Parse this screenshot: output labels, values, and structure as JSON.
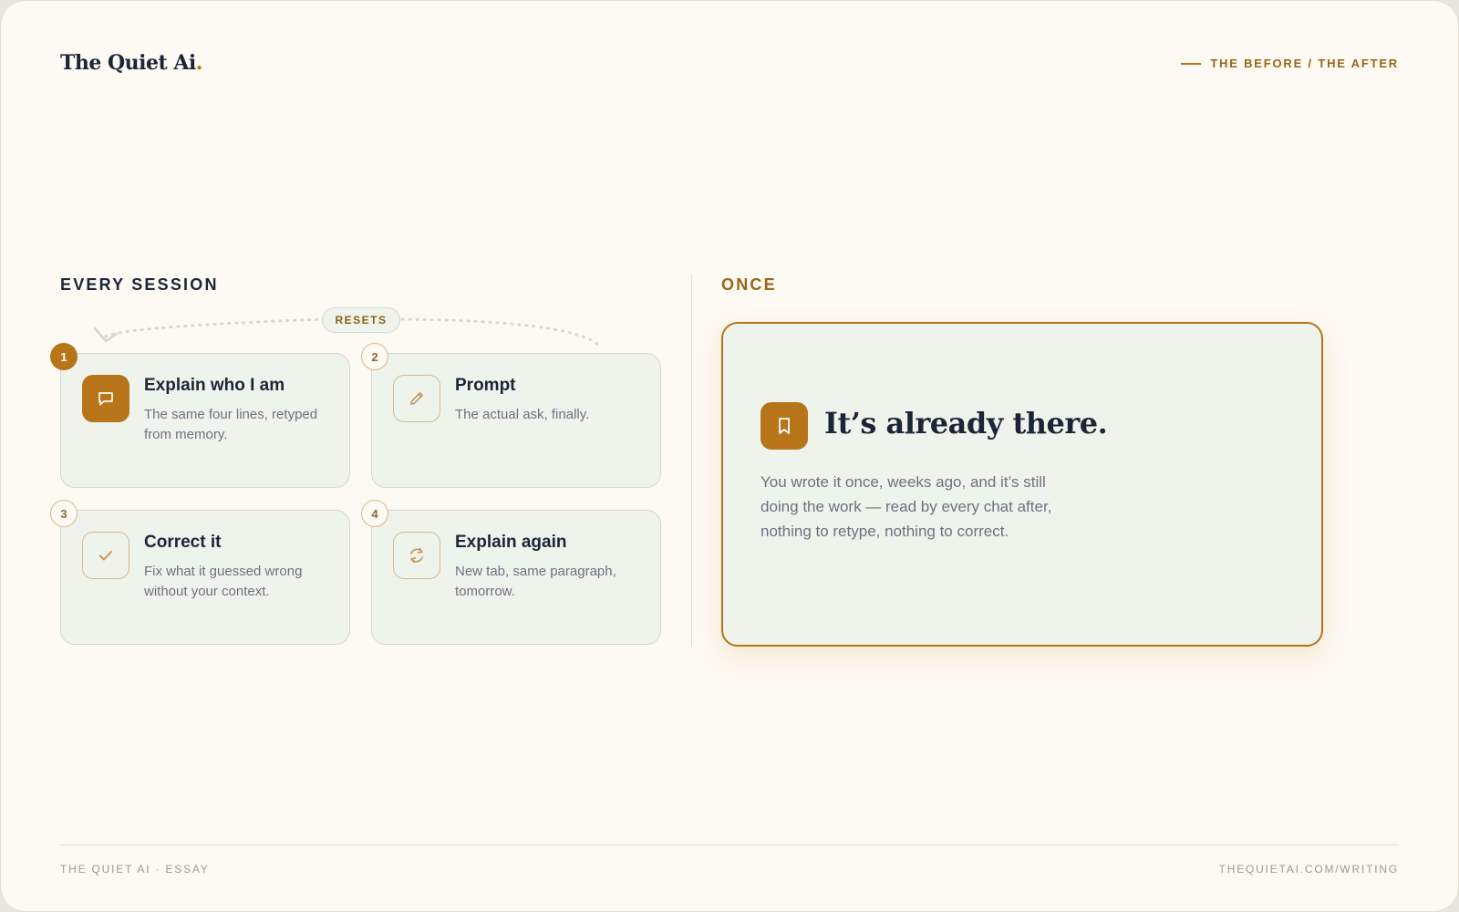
{
  "header": {
    "brand_name": "The Quiet Ai",
    "brand_dot": ".",
    "kicker": "THE BEFORE / THE AFTER"
  },
  "before": {
    "label": "EVERY SESSION",
    "loop_label": "RESETS",
    "steps": [
      {
        "number": "1",
        "title": "Explain who I am",
        "description": "The same four lines, retyped from memory.",
        "icon": "chat-bubble-icon",
        "highlighted": true
      },
      {
        "number": "2",
        "title": "Prompt",
        "description": "The actual ask, finally.",
        "icon": "pencil-icon",
        "highlighted": false
      },
      {
        "number": "3",
        "title": "Correct it",
        "description": "Fix what it guessed wrong without your context.",
        "icon": "checkmark-icon",
        "highlighted": false
      },
      {
        "number": "4",
        "title": "Explain again",
        "description": "New tab, same paragraph, tomorrow.",
        "icon": "refresh-icon",
        "highlighted": false
      }
    ]
  },
  "after": {
    "label": "ONCE",
    "title": "It’s already there.",
    "body": "You wrote it once, weeks ago, and it’s still doing the work — read by every chat after, nothing to retype, nothing to correct.",
    "icon": "bookmark-icon"
  },
  "footer": {
    "left": "THE QUIET AI · ESSAY",
    "right": "THEQUIETAI.COM/WRITING"
  },
  "colors": {
    "accent": "#b87418",
    "ink": "#1c2536",
    "card_bg": "#eef3ec",
    "page_bg": "#fdf9f3"
  }
}
